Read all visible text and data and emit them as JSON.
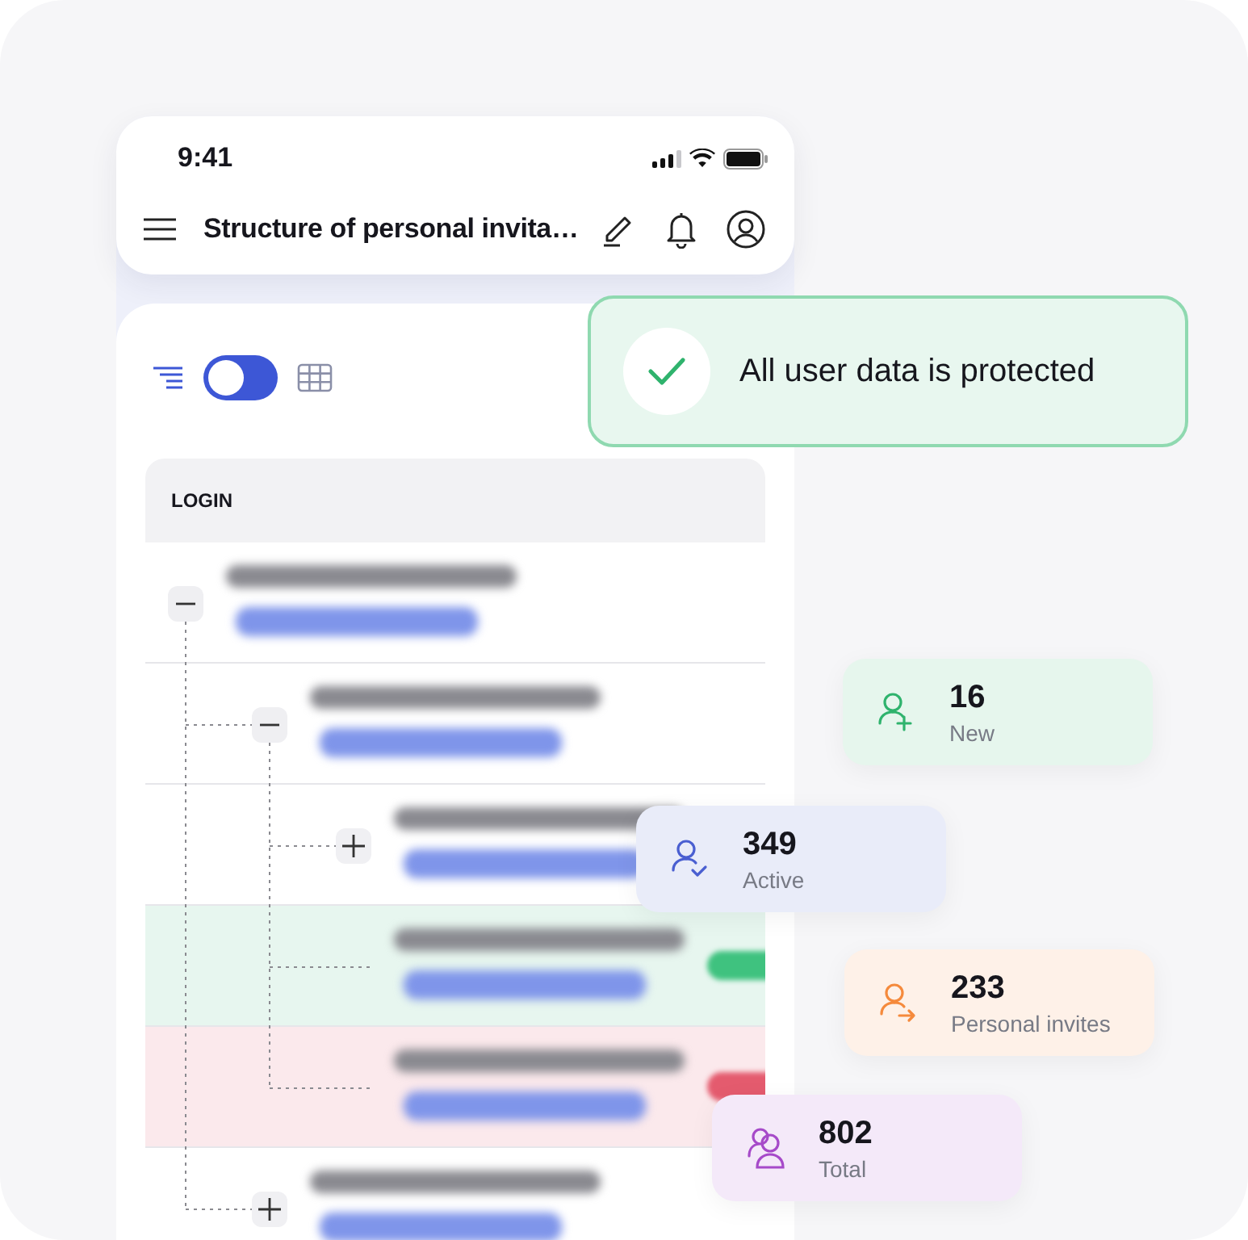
{
  "status_bar": {
    "time": "9:41"
  },
  "header": {
    "title": "Structure of personal invita…"
  },
  "views": [
    {
      "kind": "tree",
      "selected": true
    },
    {
      "kind": "table",
      "selected": false
    }
  ],
  "table": {
    "column": "LOGIN",
    "rows": [
      {
        "kind": "branch",
        "expanded": true,
        "children": [
          {
            "kind": "branch",
            "expanded": true,
            "children": [
              {
                "kind": "branch",
                "expanded": false
              },
              {
                "kind": "leaf",
                "color": "#e7f6ef",
                "badge": {
                  "color": "#3fc27f"
                }
              },
              {
                "kind": "leaf",
                "color": "#fbe9ec",
                "badge": {
                  "color": "#e45b6e"
                }
              }
            ]
          },
          {
            "kind": "branch",
            "expanded": false
          }
        ]
      }
    ]
  },
  "toast": {
    "text": "All user data is protected"
  },
  "stats": [
    {
      "kind": "new",
      "value": "16",
      "label": "New",
      "color": "#2fb36d"
    },
    {
      "kind": "active",
      "value": "349",
      "label": "Active",
      "color": "#4a5fd1"
    },
    {
      "kind": "invites",
      "value": "233",
      "label": "Personal invites",
      "color": "#f58a3c"
    },
    {
      "kind": "total",
      "value": "802",
      "label": "Total",
      "color": "#a64ac9"
    }
  ]
}
